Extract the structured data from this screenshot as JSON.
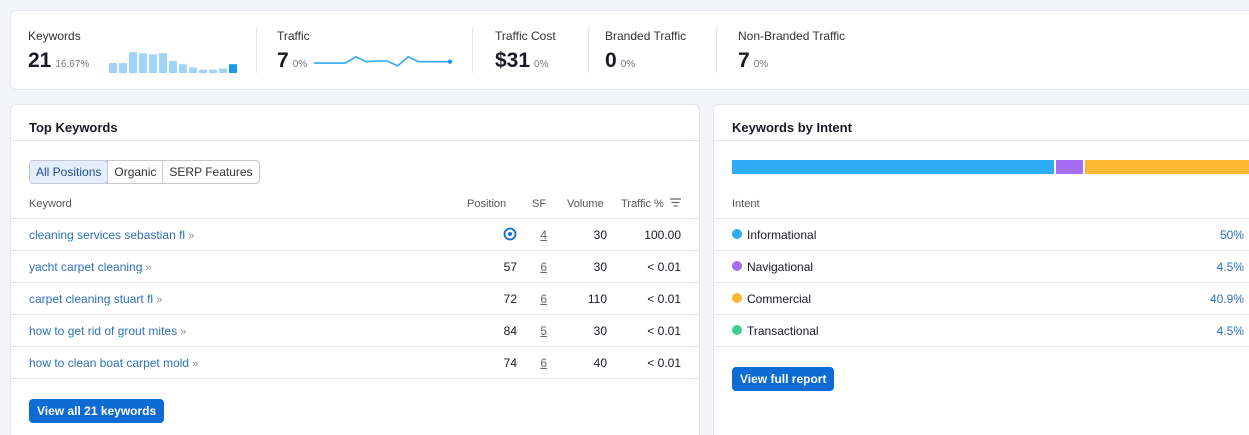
{
  "summary": {
    "keywords": {
      "label": "Keywords",
      "value": "21",
      "pct": "16.67%",
      "bars": [
        0.45,
        0.45,
        0.95,
        0.9,
        0.85,
        0.9,
        0.55,
        0.4,
        0.25,
        0.15,
        0.15,
        0.2,
        0.4
      ]
    },
    "traffic": {
      "label": "Traffic",
      "value": "7",
      "pct": "0%",
      "trend": [
        0.35,
        0.35,
        0.35,
        0.35,
        0.8,
        0.45,
        0.5,
        0.5,
        0.15,
        0.8,
        0.45,
        0.45,
        0.45,
        0.45
      ]
    },
    "traffic_cost": {
      "label": "Traffic Cost",
      "value": "$31",
      "pct": "0%"
    },
    "branded": {
      "label": "Branded Traffic",
      "value": "0",
      "pct": "0%"
    },
    "non_branded": {
      "label": "Non-Branded Traffic",
      "value": "7",
      "pct": "0%"
    }
  },
  "top_keywords": {
    "title": "Top Keywords",
    "tabs": [
      "All Positions",
      "Organic",
      "SERP Features"
    ],
    "columns": {
      "keyword": "Keyword",
      "position": "Position",
      "sf": "SF",
      "volume": "Volume",
      "traffic": "Traffic %"
    },
    "rows": [
      {
        "keyword": "cleaning services sebastian fl",
        "position": "",
        "position_icon": "location-pin-icon",
        "sf": "4",
        "volume": "30",
        "traffic": "100.00"
      },
      {
        "keyword": "yacht carpet cleaning",
        "position": "57",
        "sf": "6",
        "volume": "30",
        "traffic": "< 0.01"
      },
      {
        "keyword": "carpet cleaning stuart fl",
        "position": "72",
        "sf": "6",
        "volume": "110",
        "traffic": "< 0.01"
      },
      {
        "keyword": "how to get rid of grout mites",
        "position": "84",
        "sf": "5",
        "volume": "30",
        "traffic": "< 0.01"
      },
      {
        "keyword": "how to clean boat carpet mold",
        "position": "74",
        "sf": "6",
        "volume": "40",
        "traffic": "< 0.01"
      }
    ],
    "button": "View all 21 keywords"
  },
  "intent": {
    "title": "Keywords by Intent",
    "column": "Intent",
    "items": [
      {
        "name": "Informational",
        "pct": "50%",
        "share": 0.5,
        "color": "#2eacf5"
      },
      {
        "name": "Navigational",
        "pct": "4.5%",
        "share": 0.045,
        "color": "#a66cf2"
      },
      {
        "name": "Commercial",
        "pct": "40.9%",
        "share": 0.409,
        "color": "#fdb833"
      },
      {
        "name": "Transactional",
        "pct": "4.5%",
        "share": 0.045,
        "color": "#3fcf8e"
      }
    ],
    "button": "View full report"
  },
  "colors": {
    "accent": "#0f6bd4",
    "link": "#2e6fb7",
    "spark": "#2eacf5"
  }
}
